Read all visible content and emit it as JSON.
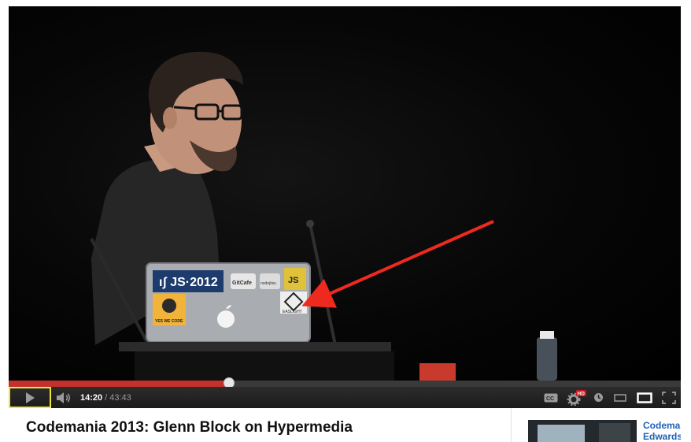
{
  "video": {
    "title": "Codemania 2013: Glenn Block on Hypermedia",
    "stickers": {
      "nodejs": "ıʃ JS·2012",
      "gitcafe": "GitCafe",
      "nodejitsu": "nodejitsu",
      "js": "JS",
      "octocat": "YES WE CODE",
      "easlight": "EASLIGHT"
    }
  },
  "player": {
    "current_time": "14:20",
    "separator": "/",
    "duration": "43:43",
    "progress_fraction": 0.328,
    "colors": {
      "progress": "#c4302b",
      "play_highlight": "#f2e53a",
      "hd_badge": "#cc181e"
    },
    "hd_badge": "HD",
    "cc_label": "CC",
    "icons": [
      "play-icon",
      "volume-icon",
      "cc-icon",
      "settings-icon",
      "watch-later-icon",
      "small-player-icon",
      "large-player-icon",
      "fullscreen-icon"
    ]
  },
  "sidebar": {
    "related": [
      {
        "title_line1": "Codemania",
        "title_line2": "Edwards -"
      }
    ]
  }
}
